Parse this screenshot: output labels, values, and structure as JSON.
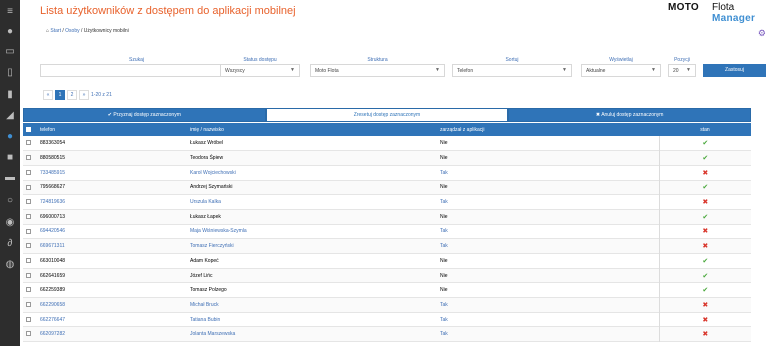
{
  "page": {
    "title": "Lista użytkowników z dostępem do aplikacji mobilnej",
    "logo": {
      "moto": "MOTO",
      "flota": "Flota",
      "manager": "Manager"
    },
    "breadcrumb": {
      "home": "Start",
      "people": "Osoby",
      "current": "Użytkownicy mobilni"
    }
  },
  "filters": {
    "search_label": "Szukaj",
    "status_label": "Status dostępu",
    "status_value": "Wszyscy",
    "structure_label": "Struktura",
    "structure_value": "Moto Flota",
    "sort_label": "Sortuj",
    "sort_value": "Telefon",
    "display_label": "Wyświetlaj",
    "display_value": "Aktualne",
    "items_label": "Pozycji",
    "items_value": "20",
    "filter_button": "Zastosuj"
  },
  "pager": {
    "prev": "«",
    "pages": [
      "1",
      "2"
    ],
    "next": "»",
    "summary": "1-20 z 21"
  },
  "actions": {
    "grant": "✔ Przyznaj dostęp zaznaczonym",
    "regen": "Zresetuj dostęp zaznaczonym",
    "revoke": "✖ Anuluj dostęp zaznaczonym"
  },
  "table": {
    "headers": {
      "phone": "telefon",
      "name": "imię / nazwisko",
      "app": "zarządzał z aplikacji",
      "status": "stan"
    },
    "rows": [
      {
        "phone": "883363054",
        "name": "Łukasz Wróbel",
        "app": "Nie",
        "status": "ok",
        "link": false
      },
      {
        "phone": "880580515",
        "name": "Teodora Śpiew",
        "app": "Nie",
        "status": "ok",
        "link": false
      },
      {
        "phone": "733485915",
        "name": "Karol Wojciechowski",
        "app": "Tak",
        "status": "no",
        "link": true
      },
      {
        "phone": "795668627",
        "name": "Andrzej Szymański",
        "app": "Nie",
        "status": "ok",
        "link": false
      },
      {
        "phone": "724819636",
        "name": "Urszula Kalka",
        "app": "Tak",
        "status": "no",
        "link": true
      },
      {
        "phone": "696000713",
        "name": "Łukasz Łapek",
        "app": "Nie",
        "status": "ok",
        "link": false
      },
      {
        "phone": "694420546",
        "name": "Maja Wiśniewska-Szymla",
        "app": "Tak",
        "status": "no",
        "link": true
      },
      {
        "phone": "669671311",
        "name": "Tomasz Fierczyński",
        "app": "Tak",
        "status": "no",
        "link": true
      },
      {
        "phone": "663010048",
        "name": "Adam Kopeć",
        "app": "Nie",
        "status": "ok",
        "link": false
      },
      {
        "phone": "662641659",
        "name": "Józef Lińc",
        "app": "Nie",
        "status": "ok",
        "link": false
      },
      {
        "phone": "662259389",
        "name": "Tomasz Polzego",
        "app": "Nie",
        "status": "ok",
        "link": false
      },
      {
        "phone": "662290658",
        "name": "Michał Bruck",
        "app": "Tak",
        "status": "no",
        "link": true
      },
      {
        "phone": "662276647",
        "name": "Tatiana Bubin",
        "app": "Tak",
        "status": "no",
        "link": true
      },
      {
        "phone": "662097282",
        "name": "Jolanta Marszewska",
        "app": "Tak",
        "status": "no",
        "link": true
      }
    ]
  }
}
